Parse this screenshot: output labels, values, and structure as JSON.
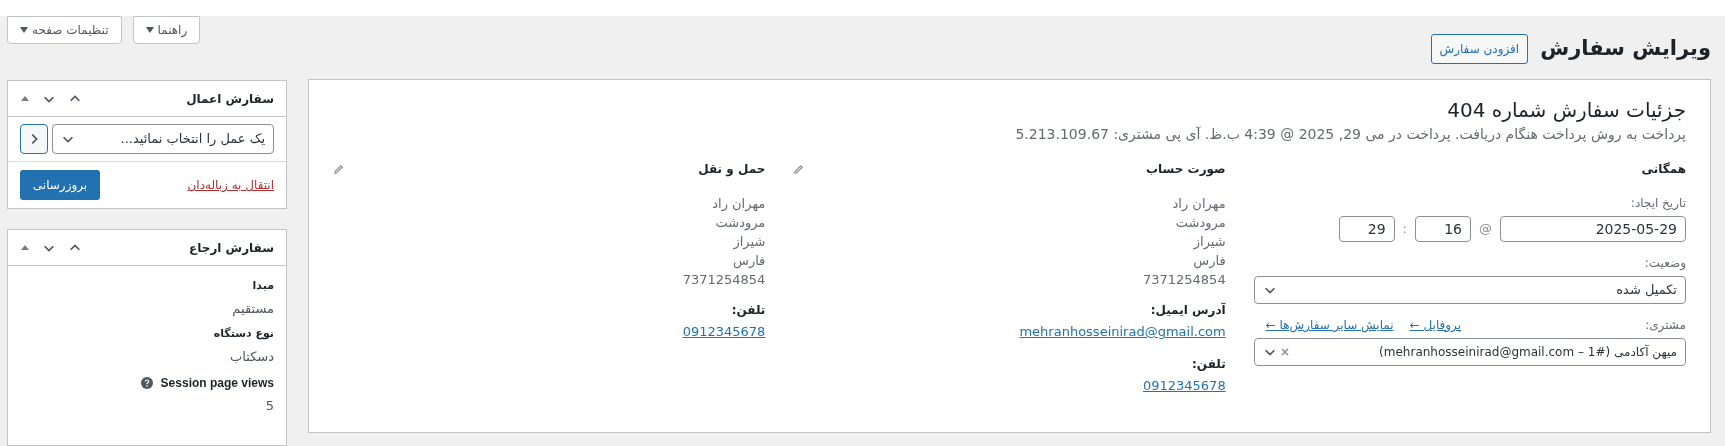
{
  "screen_options": [
    {
      "label": "راهنما"
    },
    {
      "label": "تنظیمات صفحه"
    }
  ],
  "page_title": "ویرایش سفارش",
  "add_button": "افزودن سفارش",
  "order": {
    "title": "جزئیات سفارش شماره 404",
    "subtitle": "پرداخت به روش پرداخت هنگام دریافت. پرداخت در می 29, 2025 @ 4:39 ب.ظ. آی پی مشتری: 5.213.109.67"
  },
  "general": {
    "heading": "همگانی",
    "date_label": "تاریخ ایجاد:",
    "date": "2025-05-29",
    "at": "@",
    "hour": "16",
    "colon": ":",
    "minute": "29",
    "status_label": "وضعیت:",
    "status": "تکمیل شده",
    "customer_label": "مشتری:",
    "profile_link": "پروفایل ←",
    "other_orders_link": "نمایش سایر سفارش‌ها ←",
    "customer": "میهن آکادمی (#1 – mehranhosseinirad@gmail.com)"
  },
  "billing": {
    "heading": "صورت حساب",
    "lines": [
      "مهران راد",
      "مرودشت",
      "شیراز",
      "فارس",
      "7371254854"
    ],
    "email_label": "آدرس ایمیل:",
    "email": "mehranhosseinirad@gmail.com",
    "phone_label": "تلفن:",
    "phone": "0912345678"
  },
  "shipping": {
    "heading": "حمل و نقل",
    "lines": [
      "مهران راد",
      "مرودشت",
      "شیراز",
      "فارس",
      "7371254854"
    ],
    "phone_label": "تلفن:",
    "phone": "0912345678"
  },
  "actions_box": {
    "title": "سفارش اعمال",
    "select": "یک عمل را انتخاب نمائید...",
    "trash_link": "انتقال به زباله‌دان",
    "update_button": "بروزرسانی"
  },
  "attribution_box": {
    "title": "سفارش ارجاع",
    "fields": [
      {
        "label": "مبدا",
        "value": "مستقیم",
        "help": false
      },
      {
        "label": "نوع دستگاه",
        "value": "دسکتاب",
        "help": false
      },
      {
        "label": "Session page views",
        "value": "5",
        "help": true
      }
    ]
  }
}
